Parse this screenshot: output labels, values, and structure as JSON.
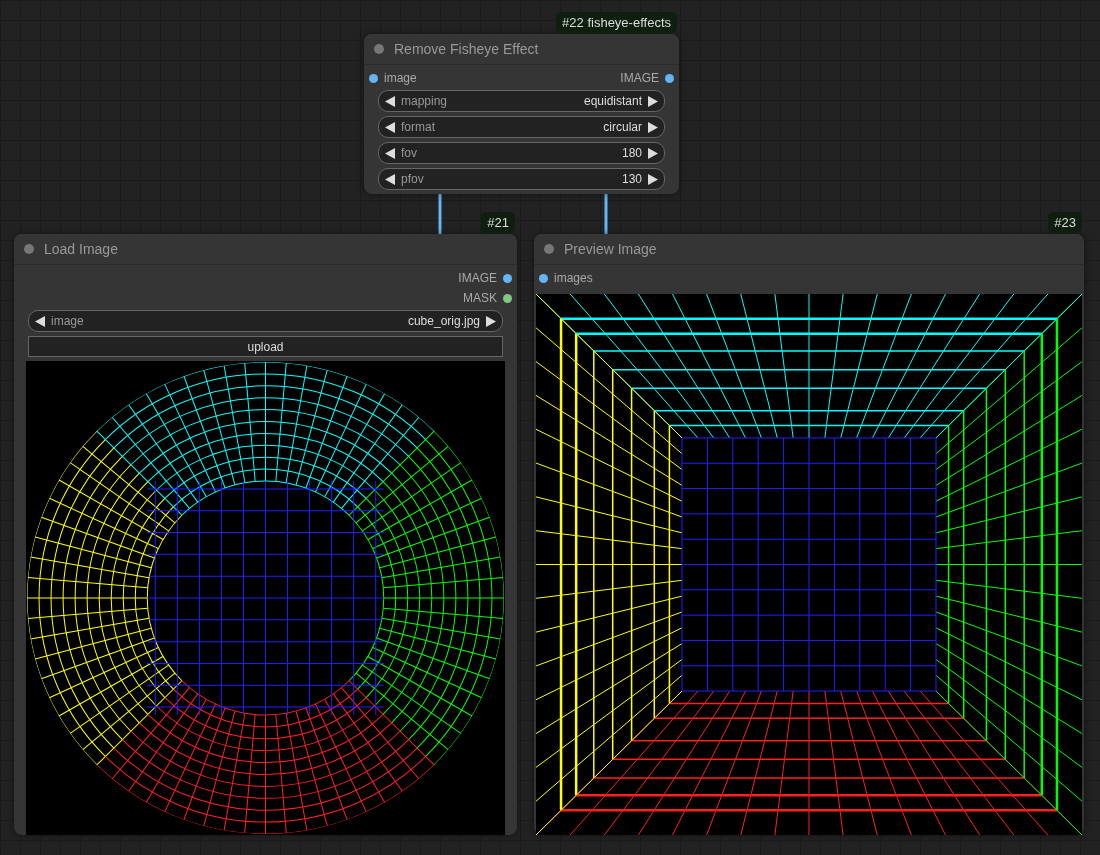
{
  "nodes": [
    {
      "badge": "#22 fisheye-effects",
      "title": "Remove Fisheye Effect",
      "inputs": [
        {
          "label": "image",
          "color": "#64b5f6"
        }
      ],
      "outputs": [
        {
          "label": "IMAGE",
          "color": "#64b5f6"
        }
      ],
      "widgets": [
        {
          "kind": "combo",
          "label": "mapping",
          "value": "equidistant"
        },
        {
          "kind": "combo",
          "label": "format",
          "value": "circular"
        },
        {
          "kind": "combo",
          "label": "fov",
          "value": "180"
        },
        {
          "kind": "combo",
          "label": "pfov",
          "value": "130"
        }
      ]
    },
    {
      "badge": "#21",
      "title": "Load Image",
      "outputs": [
        {
          "label": "IMAGE",
          "color": "#64b5f6"
        },
        {
          "label": "MASK",
          "color": "#81c784"
        }
      ],
      "widgets": [
        {
          "kind": "combo",
          "label": "image",
          "value": "cube_orig.jpg"
        },
        {
          "kind": "button",
          "label": "upload"
        }
      ]
    },
    {
      "badge": "#23",
      "title": "Preview Image",
      "inputs": [
        {
          "label": "images",
          "color": "#64b5f6"
        }
      ]
    }
  ]
}
